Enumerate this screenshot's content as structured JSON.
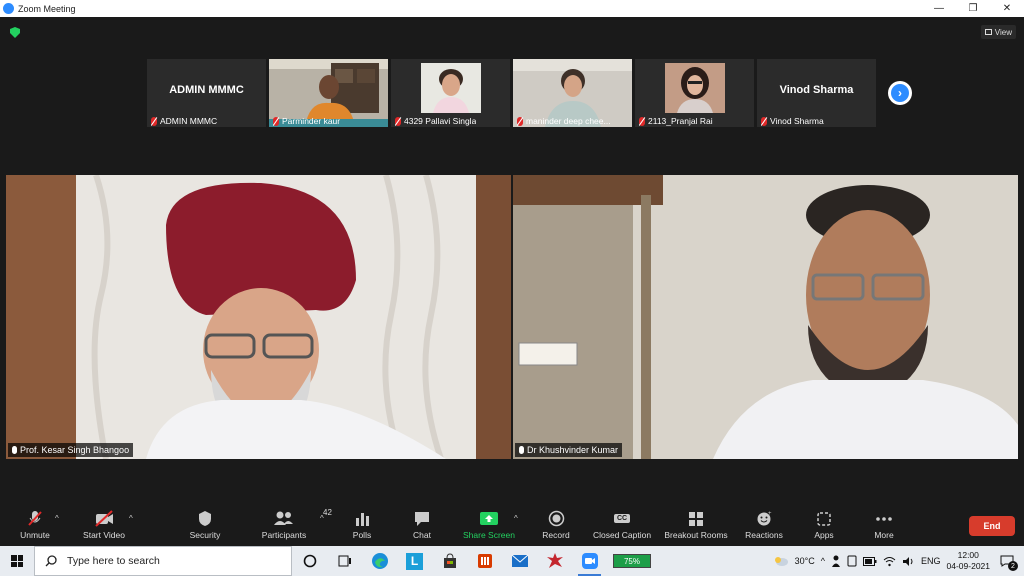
{
  "window": {
    "title": "Zoom Meeting",
    "minimize": "—",
    "maximize": "❐",
    "close": "✕"
  },
  "view_button": {
    "label": "View"
  },
  "participants_strip": [
    {
      "big_name": "ADMIN MMMC",
      "label": "ADMIN MMMC",
      "has_video": false
    },
    {
      "big_name": "",
      "label": "Parminder kaur",
      "has_video": true
    },
    {
      "big_name": "",
      "label": "4329 Pallavi Singla",
      "has_video": true
    },
    {
      "big_name": "",
      "label": "maninder deep chee...",
      "has_video": true
    },
    {
      "big_name": "",
      "label": "2113_Pranjal Rai",
      "has_video": true
    },
    {
      "big_name": "Vinod Sharma",
      "label": "Vinod Sharma",
      "has_video": false
    }
  ],
  "main_tiles": [
    {
      "name": "Prof. Kesar Singh Bhangoo"
    },
    {
      "name": "Dr Khushvinder Kumar"
    }
  ],
  "toolbar": {
    "unmute": "Unmute",
    "start_video": "Start Video",
    "security": "Security",
    "participants": "Participants",
    "participants_count": "42",
    "polls": "Polls",
    "chat": "Chat",
    "share_screen": "Share Screen",
    "record": "Record",
    "closed_caption": "Closed Caption",
    "closed_caption_icon_text": "CC",
    "breakout_rooms": "Breakout Rooms",
    "reactions": "Reactions",
    "apps": "Apps",
    "more": "More",
    "end": "End"
  },
  "colors": {
    "accent_green": "#23d160",
    "zoom_blue": "#2d8cff",
    "end_red": "#d73c2c",
    "muted_red": "#e02828"
  },
  "taskbar": {
    "search_placeholder": "Type here to search",
    "battery_app_value": "75%",
    "weather": "30°C",
    "language": "ENG",
    "time": "12:00",
    "date": "04-09-2021",
    "notification_count": "2",
    "l_app_label": "L"
  }
}
